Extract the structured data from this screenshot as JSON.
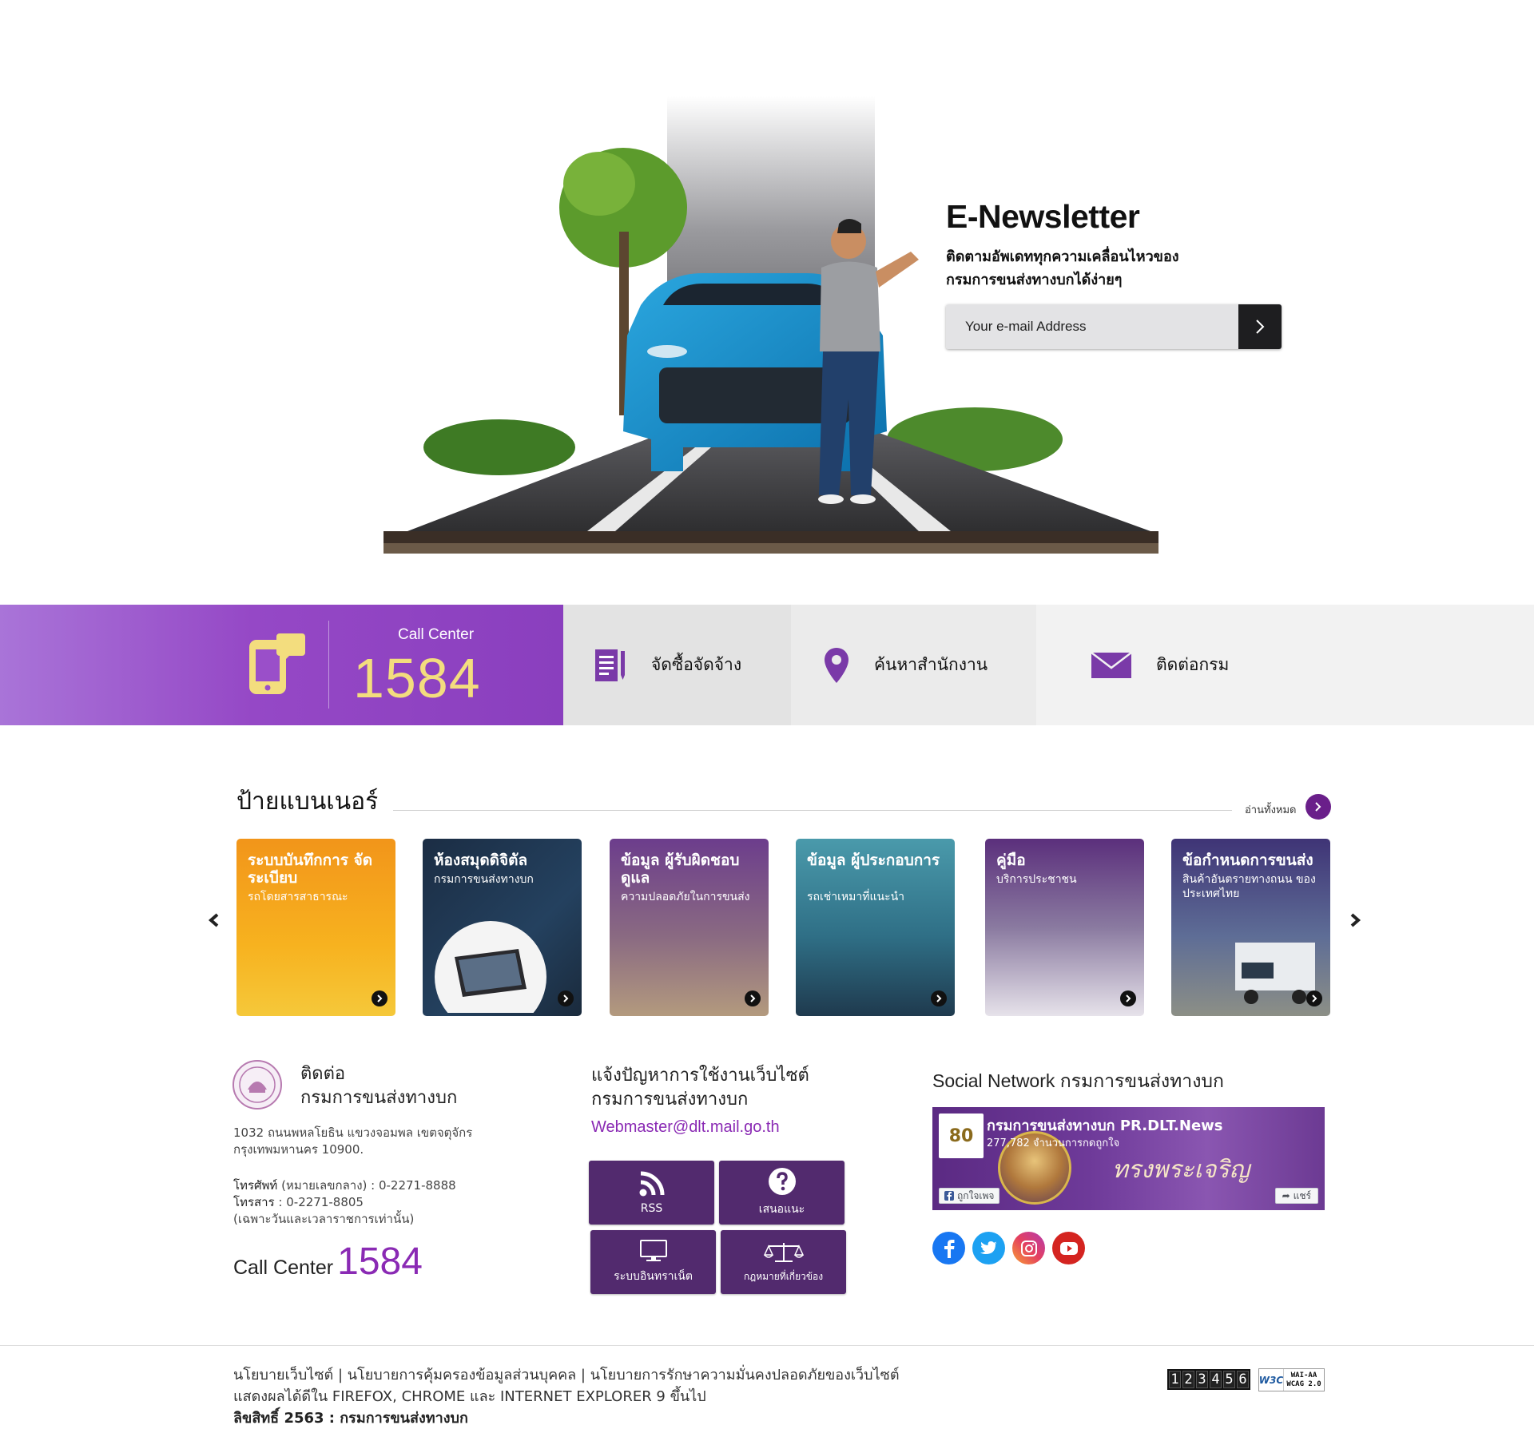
{
  "newsletter": {
    "title": "E-Newsletter",
    "line1": "ติดตามอัพเดททุกความเคลื่อนไหวของ",
    "line2": "กรมการขนส่งทางบกได้ง่ายๆ",
    "email_placeholder": "Your e-mail Address",
    "submit_icon": "chevron-right-icon"
  },
  "quickbar": {
    "call_center_label": "Call Center",
    "call_center_number": "1584",
    "items": [
      {
        "label": "จัดซื้อจัดจ้าง",
        "icon": "document-icon"
      },
      {
        "label": "ค้นหาสำนักงาน",
        "icon": "map-pin-icon"
      },
      {
        "label": "ติดต่อกรม",
        "icon": "mail-icon"
      }
    ],
    "colors": {
      "call_bg": "#9548c6",
      "number": "#f3dd7e",
      "icon": "#7a3aa8"
    }
  },
  "banners": {
    "title": "ป้ายแบนเนอร์",
    "read_all": "อ่านทั้งหมด",
    "cards": [
      {
        "title": "ระบบบันทึกการ จัดระเบียบ",
        "subtitle": "รถโดยสารสาธารณะ",
        "bg": "#f0a21c"
      },
      {
        "title": "ห้องสมุดดิจิตัล",
        "subtitle": "กรมการขนส่งทางบก",
        "bg": "#1d3550"
      },
      {
        "title": "ข้อมูล ผู้รับผิดชอบดูแล",
        "subtitle": "ความปลอดภัยในการขนส่ง",
        "bg": "#6f3f8e"
      },
      {
        "title": "ข้อมูล ผู้ประกอบการ",
        "subtitle": "รถเช่าเหมาที่แนะนำ",
        "bg": "#3d8a99"
      },
      {
        "title": "คู่มือ",
        "subtitle": "บริการประชาชน",
        "bg": "#5a2f7a"
      },
      {
        "title": "ข้อกำหนดการขนส่ง",
        "subtitle": "สินค้าอันตรายทางถนน ของประเทศไทย",
        "bg": "#4a2b6e"
      }
    ]
  },
  "contact": {
    "title_line1": "ติดต่อ",
    "title_line2": "กรมการขนส่งทางบก",
    "address_line1": "1032 ถนนพหลโยธิน แขวงจอมพล เขตจตุจักร",
    "address_line2": "กรุงเทพมหานคร 10900.",
    "phone_label": "โทรศัพท์",
    "phone_value": "(หมายเลขกลาง) : 0-2271-8888",
    "fax_label": "โทรสาร",
    "fax_value": ": 0-2271-8805",
    "hours_note": "(เฉพาะวันและเวลาราชการเท่านั้น)",
    "call_center_label": "Call Center",
    "call_center_number": "1584"
  },
  "webmaster": {
    "title_line1": "แจ้งปัญหาการใช้งานเว็บไซต์",
    "title_line2": "กรมการขนส่งทางบก",
    "email": "Webmaster@dlt.mail.go.th",
    "tiles": [
      {
        "label": "RSS",
        "icon": "rss-icon"
      },
      {
        "label": "เสนอแนะ",
        "icon": "question-icon"
      },
      {
        "label": "ระบบอินทราเน็ต",
        "icon": "monitor-icon"
      },
      {
        "label": "กฎหมายที่เกี่ยวข้อง",
        "icon": "scales-icon"
      }
    ]
  },
  "social": {
    "title": "Social Network กรมการขนส่งทางบก",
    "fb_page_name": "กรมการขนส่งทางบก PR.DLT.News",
    "fb_likes": "277,782 จำนวนการกดถูกใจ",
    "fb_logo_text": "80",
    "fb_script": "ทรงพระเจริญ",
    "fb_like_btn": "ถูกใจเพจ",
    "fb_share_btn": "แชร์",
    "icons": [
      {
        "name": "facebook-icon",
        "color": "#1877f2"
      },
      {
        "name": "twitter-icon",
        "color": "#1da1f2"
      },
      {
        "name": "instagram-icon",
        "color": "#e1306c"
      },
      {
        "name": "youtube-icon",
        "color": "#e62117"
      }
    ]
  },
  "footer": {
    "links": "นโยบายเว็บไซต์ | นโยบายการคุ้มครองข้อมูลส่วนบุคคล | นโยบายการรักษาความมั่นคงปลอดภัยของเว็บไซต์",
    "browser_note": "แสดงผลได้ดีใน FIREFOX, CHROME และ INTERNET EXPLORER 9 ขึ้นไป",
    "copyright": "ลิขสิทธิ์ 2563 : กรมการขนส่งทางบก",
    "counter_digits": [
      "1",
      "2",
      "3",
      "4",
      "5",
      "6"
    ],
    "w3c_logo": "W3C",
    "wcag_line1": "WAI-AA",
    "wcag_line2": "WCAG 2.0"
  }
}
